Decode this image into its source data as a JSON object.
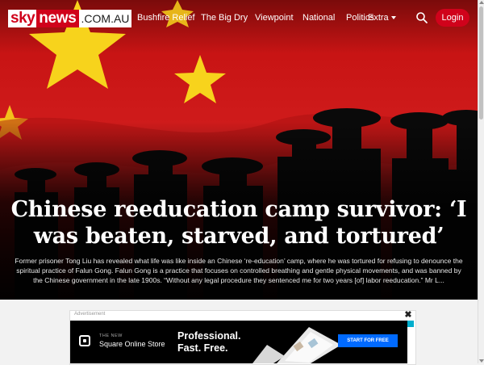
{
  "header": {
    "logo": {
      "sky": "sky",
      "news": "news",
      "domain": ".COM.AU"
    },
    "nav": [
      {
        "label": "Bushfire Relief"
      },
      {
        "label": "The Big Dry"
      },
      {
        "label": "Viewpoint"
      },
      {
        "label": "National"
      },
      {
        "label": "Politics"
      },
      {
        "label": "Extra"
      }
    ],
    "search_icon": "search-icon",
    "login_label": "Login"
  },
  "hero": {
    "headline": "Chinese reeducation camp survivor: ‘I was beaten, starved, and tortured’",
    "summary": "Former prisoner Tong Liu has revealed what life was like inside an Chinese ‘re-education’ camp, where he was tortured for refusing to denounce the spiritual practice of Falun Gong. Falun Gong is a practice that focuses on controlled breathing and gentle physical movements, and was banned by the Chinese government in the late 1900s. “Without any legal procedure they sentenced me for two years [of] labor reeducation.” Mr L..."
  },
  "advertisement": {
    "label": "Advertisement",
    "close_label": "✖",
    "brand_tag": "THE NEW",
    "brand_name": "Square Online Store",
    "headline_1": "Professional.",
    "headline_2": "Fast. Free.",
    "cta": "START FOR FREE"
  },
  "colors": {
    "brand_red": "#d0021b",
    "flag_red": "#d01c1c",
    "star_yellow": "#f7d31c",
    "cta_blue": "#006aff"
  }
}
